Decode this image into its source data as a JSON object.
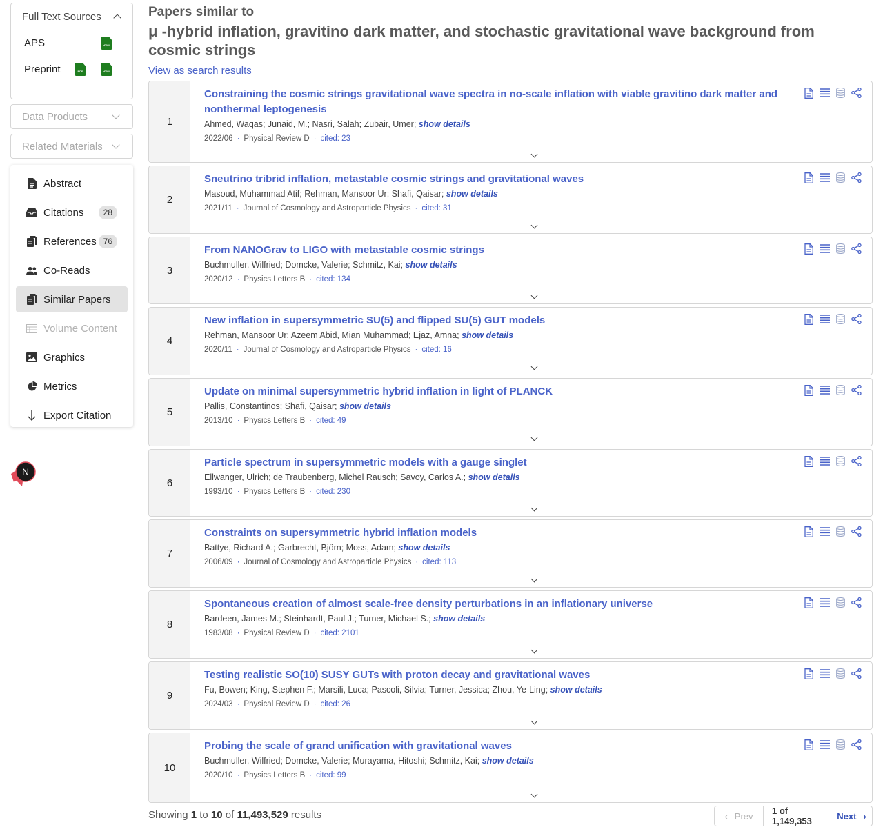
{
  "sidebar": {
    "full_text": {
      "heading": "Full Text Sources",
      "sources": [
        {
          "label": "APS",
          "files": [
            "HTML"
          ]
        },
        {
          "label": "Preprint",
          "files": [
            "PDF",
            "HTML"
          ]
        }
      ]
    },
    "data_products": "Data Products",
    "related_materials": "Related Materials",
    "nav": [
      {
        "label": "Abstract",
        "icon": "document-icon"
      },
      {
        "label": "Citations",
        "icon": "inbox-icon",
        "count": "28"
      },
      {
        "label": "References",
        "icon": "copy-documents-icon",
        "count": "76"
      },
      {
        "label": "Co-Reads",
        "icon": "users-icon"
      },
      {
        "label": "Similar Papers",
        "icon": "documents-icon",
        "active": true
      },
      {
        "label": "Volume Content",
        "icon": "table-icon",
        "disabled": true
      },
      {
        "label": "Graphics",
        "icon": "image-icon"
      },
      {
        "label": "Metrics",
        "icon": "pie-chart-icon"
      },
      {
        "label": "Export Citation",
        "icon": "arrow-down-icon"
      }
    ],
    "avatar_letter": "N"
  },
  "header": {
    "pre_title": "Papers similar to",
    "title": "μ -hybrid inflation, gravitino dark matter, and stochastic gravitational wave background from cosmic strings",
    "view_as_search": "View as search results"
  },
  "results": [
    {
      "num": "1",
      "title": "Constraining the cosmic strings gravitational wave spectra in no-scale inflation with viable gravitino dark matter and nonthermal leptogenesis",
      "authors": "Ahmed, Waqas; Junaid, M.; Nasri, Salah; Zubair, Umer;",
      "date": "2022/06",
      "journal": "Physical Review D",
      "cited": "cited: 23"
    },
    {
      "num": "2",
      "title": "Sneutrino tribrid inflation, metastable cosmic strings and gravitational waves",
      "authors": "Masoud, Muhammad Atif; Rehman, Mansoor Ur; Shafi, Qaisar;",
      "date": "2021/11",
      "journal": "Journal of Cosmology and Astroparticle Physics",
      "cited": "cited: 31"
    },
    {
      "num": "3",
      "title": "From NANOGrav to LIGO with metastable cosmic strings",
      "authors": "Buchmuller, Wilfried; Domcke, Valerie; Schmitz, Kai;",
      "date": "2020/12",
      "journal": "Physics Letters B",
      "cited": "cited: 134"
    },
    {
      "num": "4",
      "title": "New inflation in supersymmetric SU(5) and flipped SU(5) GUT models",
      "authors": "Rehman, Mansoor Ur; Azeem Abid, Mian Muhammad; Ejaz, Amna;",
      "date": "2020/11",
      "journal": "Journal of Cosmology and Astroparticle Physics",
      "cited": "cited: 16"
    },
    {
      "num": "5",
      "title": "Update on minimal supersymmetric hybrid inflation in light of PLANCK",
      "authors": "Pallis, Constantinos; Shafi, Qaisar;",
      "date": "2013/10",
      "journal": "Physics Letters B",
      "cited": "cited: 49"
    },
    {
      "num": "6",
      "title": "Particle spectrum in supersymmetric models with a gauge singlet",
      "authors": "Ellwanger, Ulrich; de Traubenberg, Michel Rausch; Savoy, Carlos A.;",
      "date": "1993/10",
      "journal": "Physics Letters B",
      "cited": "cited: 230"
    },
    {
      "num": "7",
      "title": "Constraints on supersymmetric hybrid inflation models",
      "authors": "Battye, Richard A.; Garbrecht, Björn; Moss, Adam;",
      "date": "2006/09",
      "journal": "Journal of Cosmology and Astroparticle Physics",
      "cited": "cited: 113"
    },
    {
      "num": "8",
      "title": "Spontaneous creation of almost scale-free density perturbations in an inflationary universe",
      "authors": "Bardeen, James M.; Steinhardt, Paul J.; Turner, Michael S.;",
      "date": "1983/08",
      "journal": "Physical Review D",
      "cited": "cited: 2101"
    },
    {
      "num": "9",
      "title": "Testing realistic SO(10) SUSY GUTs with proton decay and gravitational waves",
      "authors": "Fu, Bowen; King, Stephen F.; Marsili, Luca; Pascoli, Silvia; Turner, Jessica; Zhou, Ye-Ling;",
      "date": "2024/03",
      "journal": "Physical Review D",
      "cited": "cited: 26"
    },
    {
      "num": "10",
      "title": "Probing the scale of grand unification with gravitational waves",
      "authors": "Buchmuller, Wilfried; Domcke, Valerie; Murayama, Hitoshi; Schmitz, Kai;",
      "date": "2020/10",
      "journal": "Physics Letters B",
      "cited": "cited: 99"
    }
  ],
  "show_details": "show details",
  "footer": {
    "showing": "Showing",
    "from": "1",
    "to_word": "to",
    "to": "10",
    "of_word": "of",
    "total": "11,493,529",
    "results_word": "results"
  },
  "pagination": {
    "prev": "Prev",
    "pages": "1 of 1,149,353",
    "next": "Next"
  },
  "colors": {
    "link": "#4a63c9",
    "file_green": "#1e7d1f",
    "active_bg": "#e3e3e3"
  }
}
